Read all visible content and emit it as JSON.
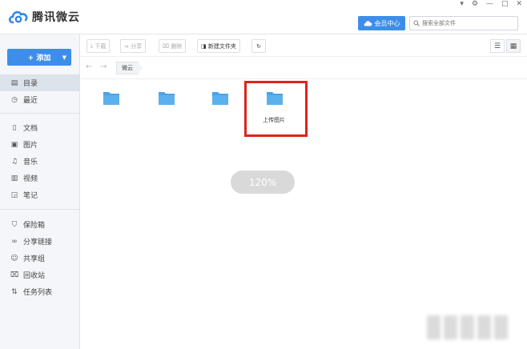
{
  "app": {
    "title": "腾讯微云"
  },
  "window_controls": {
    "minimize_dropdown": "▾",
    "settings": "⚙",
    "minimize": "—",
    "maximize": "□",
    "close": "✕"
  },
  "header": {
    "vip_label": "会员中心",
    "search_placeholder": "搜索全部文件"
  },
  "sidebar": {
    "add_label": "+ 添加",
    "group1": [
      {
        "label": "目录",
        "icon": "directory-icon"
      },
      {
        "label": "最近",
        "icon": "clock-icon"
      }
    ],
    "group2": [
      {
        "label": "文档",
        "icon": "document-icon"
      },
      {
        "label": "图片",
        "icon": "image-icon"
      },
      {
        "label": "音乐",
        "icon": "music-icon"
      },
      {
        "label": "视频",
        "icon": "video-icon"
      },
      {
        "label": "笔记",
        "icon": "note-icon"
      }
    ],
    "group3": [
      {
        "label": "保险箱",
        "icon": "shield-icon"
      },
      {
        "label": "分享链接",
        "icon": "link-icon"
      },
      {
        "label": "共享组",
        "icon": "group-icon"
      },
      {
        "label": "回收站",
        "icon": "trash-icon"
      },
      {
        "label": "任务列表",
        "icon": "transfer-icon"
      }
    ]
  },
  "toolbar": {
    "download": "下载",
    "share": "分享",
    "delete": "删除",
    "new_folder": "新建文件夹"
  },
  "breadcrumb": {
    "current": "微云"
  },
  "folders": [
    {
      "label": ""
    },
    {
      "label": ""
    },
    {
      "label": ""
    },
    {
      "label": "上传图片"
    }
  ],
  "zoom": {
    "label": "120%"
  },
  "colors": {
    "accent": "#3d8ee8",
    "folder": "#4aa3e8",
    "highlight": "#e0231b"
  }
}
